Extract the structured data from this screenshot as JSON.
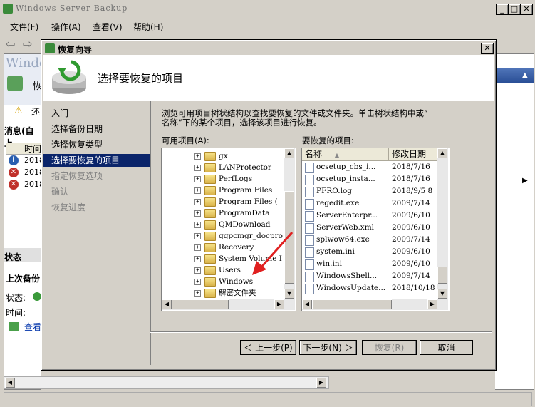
{
  "main": {
    "title": "Windows Server Backup",
    "menu": [
      "文件(F)",
      "操作(A)",
      "查看(V)",
      "帮助(H)"
    ],
    "left_partial": {
      "heading_fragment": "Windo",
      "sub_fragment": "恢",
      "warn_fragment": "还",
      "messages_label": "消息(自上",
      "time_col": "时间",
      "rows": [
        "2018",
        "2018",
        "2018"
      ],
      "status_label": "状态",
      "last_backup": "上次备份",
      "state": "状态:",
      "time": "时间:",
      "view": "查看"
    }
  },
  "dialog": {
    "title": "恢复向导",
    "heading": "选择要恢复的项目",
    "nav": [
      {
        "label": "入门",
        "state": "normal"
      },
      {
        "label": "选择备份日期",
        "state": "normal"
      },
      {
        "label": "选择恢复类型",
        "state": "normal"
      },
      {
        "label": "选择要恢复的项目",
        "state": "selected"
      },
      {
        "label": "指定恢复选项",
        "state": "disabled"
      },
      {
        "label": "确认",
        "state": "disabled"
      },
      {
        "label": "恢复进度",
        "state": "disabled"
      }
    ],
    "description_line1": "浏览可用项目树状结构以查找要恢复的文件或文件夹。单击树状结构中或“",
    "description_line2": "名称”下的某个项目，选择该项目进行恢复。",
    "available_label": "可用项目(A):",
    "restore_label": "要恢复的项目:",
    "tree": [
      "gx",
      "LANProtector",
      "PerfLogs",
      "Program Files",
      "Program Files (",
      "ProgramData",
      "QMDownload",
      "qqpcmgr_docpro",
      "Recovery",
      "System Volume I",
      "Users",
      "Windows",
      "解密文件夹"
    ],
    "columns": {
      "name": "名称",
      "modified": "修改日期"
    },
    "files": [
      {
        "name": "ocsetup_cbs_i...",
        "date": "2018/7/16"
      },
      {
        "name": "ocsetup_insta...",
        "date": "2018/7/16"
      },
      {
        "name": "PFRO.log",
        "date": "2018/9/5 8"
      },
      {
        "name": "regedit.exe",
        "date": "2009/7/14"
      },
      {
        "name": "ServerEnterpr...",
        "date": "2009/6/10"
      },
      {
        "name": "ServerWeb.xml",
        "date": "2009/6/10"
      },
      {
        "name": "splwow64.exe",
        "date": "2009/7/14"
      },
      {
        "name": "system.ini",
        "date": "2009/6/10"
      },
      {
        "name": "win.ini",
        "date": "2009/6/10"
      },
      {
        "name": "WindowsShell...",
        "date": "2009/7/14"
      },
      {
        "name": "WindowsUpdate...",
        "date": "2018/10/18"
      }
    ],
    "buttons": {
      "back": "＜ 上一步(P)",
      "next": "下一步(N) ＞",
      "restore": "恢复(R)",
      "cancel": "取消"
    }
  }
}
